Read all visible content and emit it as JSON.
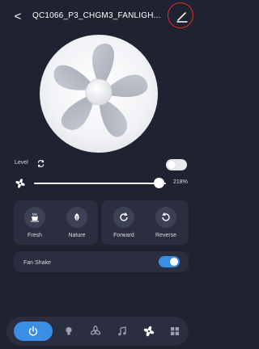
{
  "header": {
    "back_glyph": "<",
    "title": "QC1066_P3_CHGM3_FANLIGH..."
  },
  "controls": {
    "level_label": "Level",
    "level_toggle_on": false,
    "speed_percent_label": "218%",
    "speed_level": 0.95
  },
  "modes": [
    {
      "label": "Fresh",
      "icon": "cup-icon"
    },
    {
      "label": "Nature",
      "icon": "leaf-icon"
    },
    {
      "label": "Forward",
      "icon": "rotate-forward-icon"
    },
    {
      "label": "Reverse",
      "icon": "rotate-reverse-icon"
    }
  ],
  "fan_shake": {
    "label": "Fan Shake",
    "on": true
  },
  "nav": [
    "power-icon",
    "lightbulb-icon",
    "fan-outline-icon",
    "music-note-icon",
    "fan-icon",
    "grid-icon"
  ],
  "colors": {
    "background": "#1f2230",
    "card": "#2a2e3e",
    "accent": "#3a8ee6",
    "highlight_circle": "#e02b2b"
  }
}
